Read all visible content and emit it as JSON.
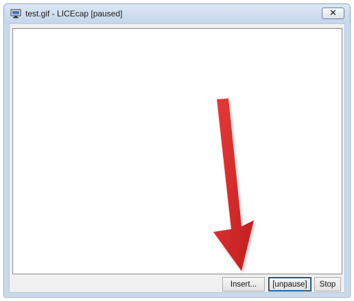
{
  "window": {
    "title": "test.gif - LICEcap [paused]",
    "icon": "monitor-icon",
    "close_symbol": "✕"
  },
  "buttons": {
    "insert_label": "Insert...",
    "unpause_label": "[unpause]",
    "stop_label": "Stop"
  },
  "colors": {
    "arrow": "#d92a2a",
    "titlebar": "#c9d9ec"
  }
}
